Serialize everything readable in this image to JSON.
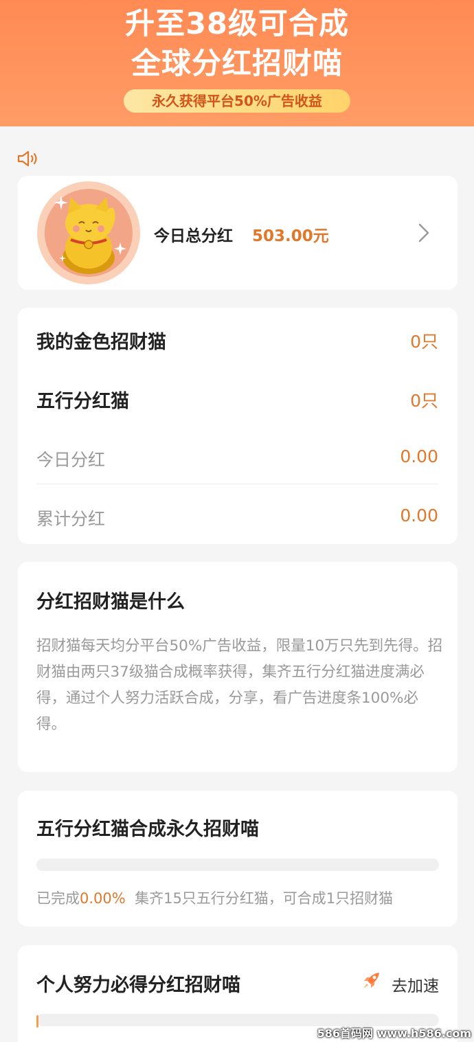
{
  "hero": {
    "line1": "升至38级可合成",
    "line2": "全球分红招财喵",
    "pill": "永久获得平台50%广告收益"
  },
  "summary": {
    "label": "今日总分红",
    "value": "503.00元"
  },
  "stats": {
    "golden_cat_label": "我的金色招财猫",
    "golden_cat_value": "0只",
    "wuxing_cat_label": "五行分红猫",
    "wuxing_cat_value": "0只",
    "today_label": "今日分红",
    "today_value": "0.00",
    "total_label": "累计分红",
    "total_value": "0.00"
  },
  "about": {
    "title": "分红招财猫是什么",
    "text": "招财猫每天均分平台50%广告收益，限量10万只先到先得。招财猫由两只37级猫合成概率获得，集齐五行分红猫进度满必得，通过个人努力活跃合成，分享，看广告进度条100%必得。"
  },
  "compose": {
    "title": "五行分红猫合成永久招财喵",
    "done_prefix": "已完成",
    "done_pct": "0.00%",
    "hint": "集齐15只五行分红猫，可合成1只招财猫",
    "progress": 0
  },
  "effort": {
    "title": "个人努力必得分红招财喵",
    "speed_label": "去加速",
    "progress": 0
  },
  "watermark": "586首码网 www.h586.com",
  "colors": {
    "accent": "#e0782c",
    "hero": "#ff8a54",
    "pill": "#ffd36a"
  }
}
